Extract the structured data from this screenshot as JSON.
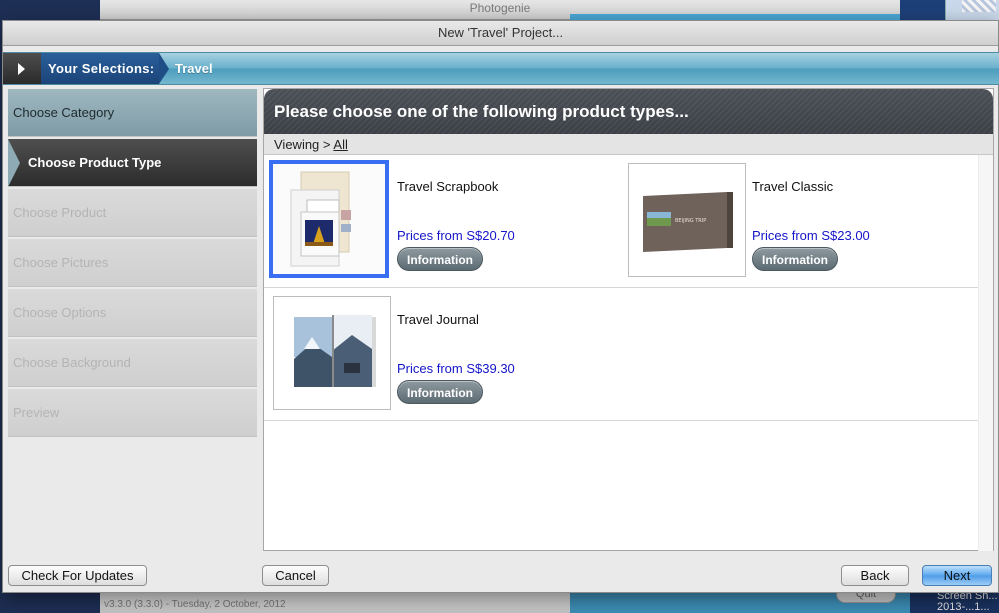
{
  "background": {
    "parent_title": "Photogenie",
    "status_text": "v3.3.0 (3.3.0) - Tuesday, 2 October, 2012",
    "quit_label": "Quit",
    "screenshot_label": "Screen Sh... 2013-...1..."
  },
  "window": {
    "title": "New 'Travel' Project..."
  },
  "selections": {
    "label": "Your Selections:",
    "value": "Travel"
  },
  "steps": [
    {
      "label": "Choose Category",
      "state": "done"
    },
    {
      "label": "Choose Product Type",
      "state": "active"
    },
    {
      "label": "Choose Product",
      "state": "disabled"
    },
    {
      "label": "Choose Pictures",
      "state": "disabled"
    },
    {
      "label": "Choose Options",
      "state": "disabled"
    },
    {
      "label": "Choose Background",
      "state": "disabled"
    },
    {
      "label": "Preview",
      "state": "disabled"
    }
  ],
  "main": {
    "heading": "Please choose one of the following product types...",
    "viewing_label": "Viewing >",
    "viewing_link": "All"
  },
  "products": [
    {
      "name": "Travel Scrapbook",
      "price": "Prices from S$20.70",
      "info_label": "Information",
      "selected": true,
      "thumb_icon": "scrapbook-thumbnail"
    },
    {
      "name": "Travel  Classic",
      "price": "Prices from S$23.00",
      "info_label": "Information",
      "selected": false,
      "thumb_icon": "classic-book-thumbnail",
      "cover_text": "BEIJING TRIP"
    },
    {
      "name": "Travel Journal",
      "price": "Prices from S$39.30",
      "info_label": "Information",
      "selected": false,
      "thumb_icon": "journal-thumbnail"
    }
  ],
  "buttons": {
    "check_updates": "Check For Updates",
    "cancel": "Cancel",
    "back": "Back",
    "next": "Next"
  },
  "colors": {
    "accent_blue": "#3a6ef2",
    "price_blue": "#1515c9",
    "selection_bar": "#6ab1cc"
  }
}
